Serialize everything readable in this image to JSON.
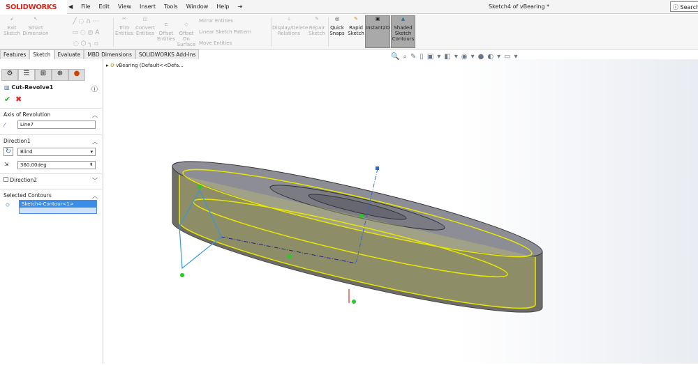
{
  "app": {
    "brand": "SOLIDWORKS",
    "title": "Sketch4 of vBearing *",
    "search": "Search S"
  },
  "menu": [
    "File",
    "Edit",
    "View",
    "Insert",
    "Tools",
    "Window",
    "Help"
  ],
  "ribbon": {
    "exit_sketch": "Exit Sketch",
    "smart_dimension": "Smart Dimension",
    "trim": "Trim Entities",
    "convert": "Convert Entities",
    "offset": "Offset Entities",
    "offset_surface": "Offset On Surface",
    "mirror": "Mirror Entities",
    "linear_pattern": "Linear Sketch Pattern",
    "move": "Move Entities",
    "display_delete": "Display/Delete Relations",
    "repair": "Repair Sketch",
    "quick_snaps": "Quick Snaps",
    "rapid_sketch": "Rapid Sketch",
    "instant2d": "Instant2D",
    "shaded": "Shaded Sketch Contours"
  },
  "tabs": [
    "Features",
    "Sketch",
    "Evaluate",
    "MBD Dimensions",
    "SOLIDWORKS Add-Ins"
  ],
  "panel": {
    "feature": "Cut-Revolve1",
    "axis_header": "Axis of Revolution",
    "axis_value": "Line7",
    "dir1_header": "Direction1",
    "dir1_type": "Blind",
    "angle": "360.00deg",
    "dir2": "Direction2",
    "contours_header": "Selected Contours",
    "contour": "Sketch4-Contour<1>"
  },
  "tree": {
    "root": "vBearing  (Default<<Defa..."
  }
}
